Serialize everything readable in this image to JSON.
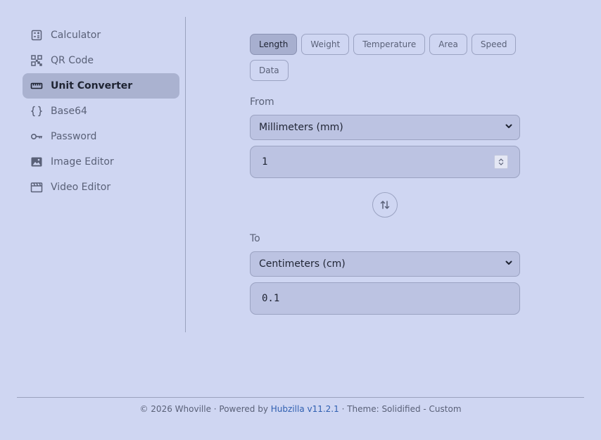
{
  "sidebar": {
    "items": [
      {
        "label": "Calculator",
        "icon": "calculator-icon"
      },
      {
        "label": "QR Code",
        "icon": "qr-code-icon"
      },
      {
        "label": "Unit Converter",
        "icon": "ruler-icon",
        "active": true
      },
      {
        "label": "Base64",
        "icon": "braces-icon"
      },
      {
        "label": "Password",
        "icon": "key-icon"
      },
      {
        "label": "Image Editor",
        "icon": "image-icon"
      },
      {
        "label": "Video Editor",
        "icon": "clapperboard-icon"
      }
    ]
  },
  "converter": {
    "tabs": [
      "Length",
      "Weight",
      "Temperature",
      "Area",
      "Speed",
      "Data"
    ],
    "active_tab": "Length",
    "from_label": "From",
    "from_unit": "Millimeters (mm)",
    "from_value": "1",
    "to_label": "To",
    "to_unit": "Centimeters (cm)",
    "to_value": "0.1"
  },
  "footer": {
    "prefix": "© 2026 Whoville · Powered by ",
    "link_text": "Hubzilla v11.2.1",
    "suffix": " · Theme: Solidified - Custom"
  },
  "colors": {
    "background": "#cfd6f2",
    "active_item": "#aab2d0",
    "link": "#2f5fb0"
  }
}
